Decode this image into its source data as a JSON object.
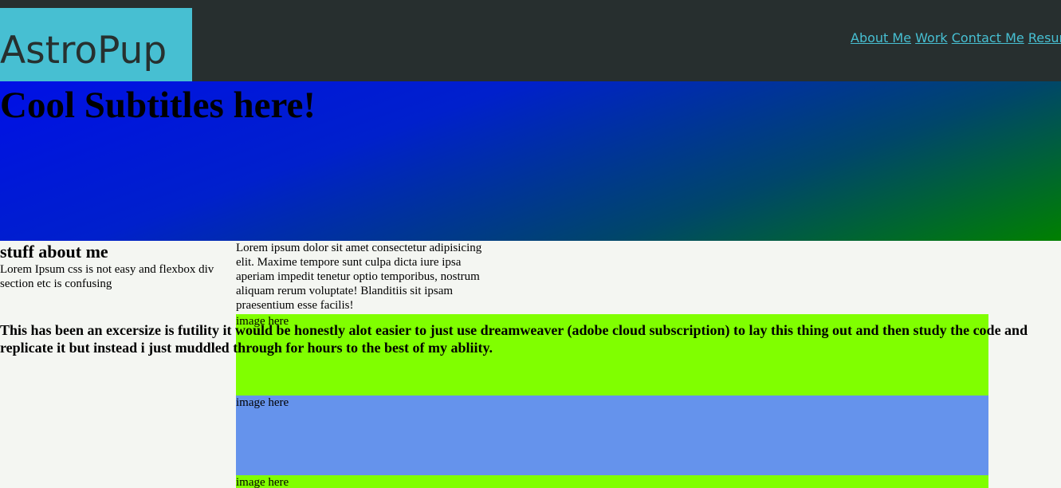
{
  "header": {
    "logo_text": "AstroPup",
    "nav": [
      "About Me",
      "Work",
      "Contact Me",
      "Resume"
    ]
  },
  "hero": {
    "title": "Cool Subtitles here!"
  },
  "about": {
    "heading": "stuff about me",
    "text": "Lorem Ipsum css is not easy and flexbox div section etc is confusing"
  },
  "lorem": "Lorem ipsum dolor sit amet consectetur adipisicing elit. Maxime tempore sunt culpa dicta iure ipsa aperiam impedit tenetur optio temporibus, nostrum aliquam rerum voluptate! Blanditiis sit ipsam praesentium esse facilis!",
  "futility": "This has been an excersize is futility it would be honestly alot easier to just use dreamweaver (adobe cloud subscription) to lay this thing out and then study the code and replicate it but instead i just muddled through for hours to the best of my abliity.",
  "images": [
    {
      "label": "image here",
      "color": "#80ff00"
    },
    {
      "label": "image here",
      "color": "#6593ec"
    },
    {
      "label": "image here",
      "color": "#80ff00"
    }
  ],
  "colors": {
    "header_bg": "#272f2f",
    "logo_bg": "#47bfd2",
    "link": "#47bfd2",
    "page_bg": "#f4f6f2"
  }
}
